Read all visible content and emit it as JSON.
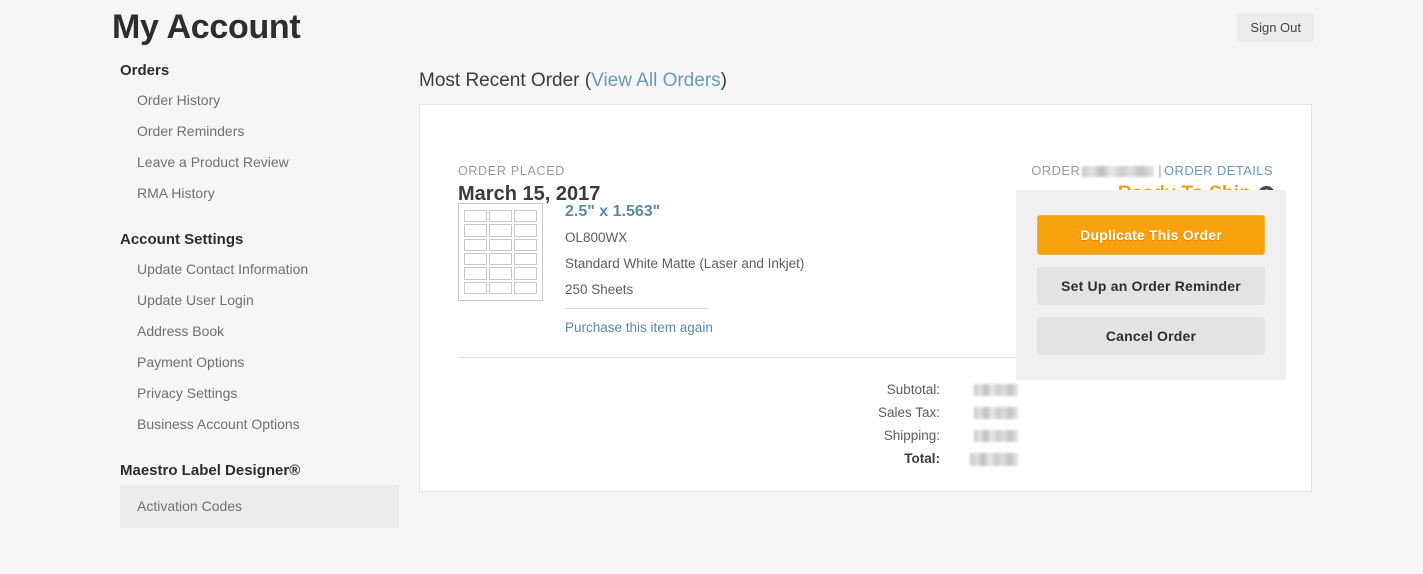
{
  "header": {
    "title": "My Account",
    "sign_out_label": "Sign Out"
  },
  "sidebar": {
    "groups": [
      {
        "title": "Orders",
        "items": [
          {
            "label": "Order History",
            "active": false
          },
          {
            "label": "Order Reminders",
            "active": false
          },
          {
            "label": "Leave a Product Review",
            "active": false
          },
          {
            "label": "RMA History",
            "active": false
          }
        ]
      },
      {
        "title": "Account Settings",
        "items": [
          {
            "label": "Update Contact Information",
            "active": false
          },
          {
            "label": "Update User Login",
            "active": false
          },
          {
            "label": "Address Book",
            "active": false
          },
          {
            "label": "Payment Options",
            "active": false
          },
          {
            "label": "Privacy Settings",
            "active": false
          },
          {
            "label": "Business Account Options",
            "active": false
          }
        ]
      },
      {
        "title": "Maestro Label Designer®",
        "items": [
          {
            "label": "Activation Codes",
            "active": true
          }
        ]
      }
    ]
  },
  "main": {
    "heading": "Most Recent Order",
    "view_all_orders_label": "View All Orders",
    "paren_open": "(",
    "paren_close": ")"
  },
  "order": {
    "placed_label": "ORDER PLACED",
    "placed_date": "March 15, 2017",
    "order_word": "ORDER",
    "order_number": "[redacted]",
    "separator": "|",
    "details_link_label": "ORDER DETAILS",
    "status": "Ready To Ship",
    "status_color": "#e8a317",
    "help_icon_glyph": "?",
    "product": {
      "size_title": "2.5\" x 1.563\"",
      "sku": "OL800WX",
      "material": "Standard White Matte (Laser and Inkjet)",
      "quantity": "250 Sheets",
      "price": "[redacted]",
      "repurchase_label": "Purchase this item again",
      "label_sheet_columns": 3,
      "label_sheet_rows": 6
    },
    "totals": [
      {
        "label": "Subtotal:",
        "value": "[redacted]"
      },
      {
        "label": "Sales Tax:",
        "value": "[redacted]"
      },
      {
        "label": "Shipping:",
        "value": "[redacted]"
      },
      {
        "label": "Total:",
        "value": "[redacted]"
      }
    ],
    "actions": {
      "duplicate_label": "Duplicate This Order",
      "reminder_label": "Set Up an Order Reminder",
      "cancel_label": "Cancel Order"
    }
  }
}
